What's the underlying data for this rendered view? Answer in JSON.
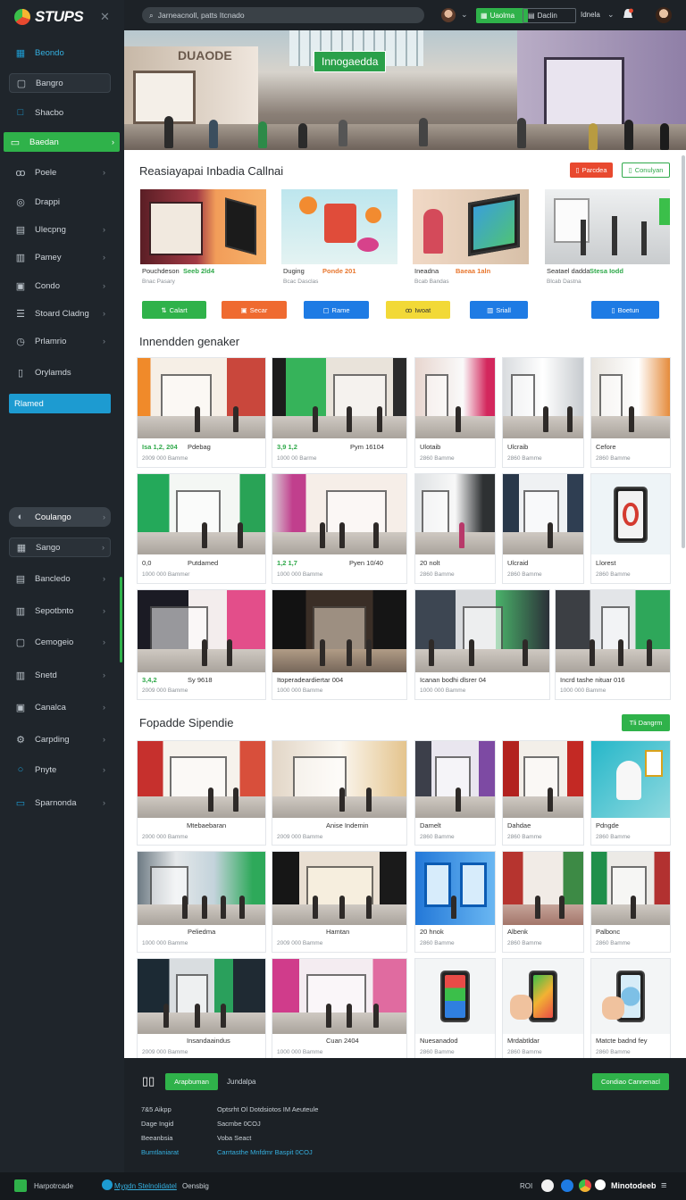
{
  "app": {
    "name": "STUPS"
  },
  "sidebar": {
    "items": [
      {
        "label": "Beondo",
        "icon": "grid-icon"
      },
      {
        "label": "Bangro",
        "icon": "square-icon"
      },
      {
        "label": "Shacbo",
        "icon": "square-outline-icon"
      },
      {
        "label": "Baedan",
        "icon": "monitor-icon"
      },
      {
        "label": "Poele",
        "icon": "users-icon"
      },
      {
        "label": "Drappi",
        "icon": "target-icon"
      },
      {
        "label": "Ulecpng",
        "icon": "panel-icon"
      },
      {
        "label": "Pamey",
        "icon": "table-icon"
      },
      {
        "label": "Condo",
        "icon": "calendar-icon"
      },
      {
        "label": "Stoard Cladng",
        "icon": "list-icon"
      },
      {
        "label": "Prlamrio",
        "icon": "clock-icon"
      },
      {
        "label": "Orylamds",
        "icon": "doc-icon"
      },
      {
        "label": "Rlamed",
        "icon": ""
      },
      {
        "label": "Coulango",
        "icon": ""
      },
      {
        "label": "Sango",
        "icon": "grid-icon"
      },
      {
        "label": "Bancledo",
        "icon": "briefcase-icon"
      },
      {
        "label": "Sepotbnto",
        "icon": "chart-icon"
      },
      {
        "label": "Cemogeio",
        "icon": "wallet-icon"
      },
      {
        "label": "Snetd",
        "icon": "building-icon"
      },
      {
        "label": "Canalca",
        "icon": "calendar-icon"
      },
      {
        "label": "Carpding",
        "icon": "settings-icon"
      },
      {
        "label": "Pnyte",
        "icon": "circle-icon"
      },
      {
        "label": "Sparnonda",
        "icon": "folder-icon"
      }
    ]
  },
  "topbar": {
    "search_placeholder": "Jarneacnoll, patts Itcnado",
    "btn_green": "Uaolma",
    "btn_dark": "Daclin",
    "text": "Idnela"
  },
  "hero": {
    "tag": "Innogaedda",
    "storefront_label": "DUAODE"
  },
  "section1": {
    "title": "Reasiayapai Inbadia Callnai",
    "btn_orange": "Parcdea",
    "btn_green": "Conulyan",
    "cards": [
      {
        "title": "Pouchdeson",
        "accent": "Seeb 2ld4",
        "meta": "Bnac  Pasary"
      },
      {
        "title": "Duging",
        "accent": "Ponde 201",
        "meta": "Bcac  Dasclas"
      },
      {
        "title": "Ineadna",
        "accent": "Baeaa 1aln",
        "meta": "Bcab  Bandas"
      },
      {
        "title": "Seatael dadda",
        "accent": "Stesa Iodd",
        "meta": "Blcab  Dastna"
      }
    ],
    "actions": [
      {
        "label": "Calart",
        "color": "#2fb24a",
        "icon": "sliders-icon"
      },
      {
        "label": "Secar",
        "color": "#ef6a30",
        "icon": "calendar-icon"
      },
      {
        "label": "Rame",
        "color": "#1e7be4",
        "icon": "frame-icon"
      },
      {
        "label": "Iwoat",
        "color": "#f2d937",
        "icon": "people-icon"
      },
      {
        "label": "Sriall",
        "color": "#1e7be4",
        "icon": "building-icon"
      },
      {
        "label": "Boetun",
        "color": "#1e7be4",
        "icon": "doc-icon"
      }
    ]
  },
  "section2": {
    "title": "Innendden genaker",
    "cards": [
      {
        "l1": "Isa 1,2,  204",
        "l1b": "Pdebag",
        "l2": "2009 000  Bamme",
        "accent": true
      },
      {
        "l1": "3,9  1,2",
        "l1b": "Pym  16104",
        "l2": "1000 00  Barme",
        "accent": true
      },
      {
        "l1": "Ulotaib",
        "l1b": "",
        "l2": "2860  Bamme",
        "accent": false
      },
      {
        "l1": "Ulcraib",
        "l1b": "",
        "l2": "2860  Bamme",
        "accent": false
      },
      {
        "l1": "Cefore",
        "l1b": "",
        "l2": "2860  Bamme",
        "accent": false
      },
      {
        "l1": "0,0",
        "l1b": "Putdamed",
        "l2": "1000 000  Bammer",
        "accent": false
      },
      {
        "l1": "1,2  1,7",
        "l1b": "Pyen  10/40",
        "l2": "1000 000  Bamme",
        "accent": true
      },
      {
        "l1": "20 nolt",
        "l1b": "",
        "l2": "2860  Bamme",
        "accent": false
      },
      {
        "l1": "Ulcraid",
        "l1b": "",
        "l2": "2860  Bamme",
        "accent": false
      },
      {
        "l1": "Llorest",
        "l1b": "",
        "l2": "2860  Bamme",
        "accent": false
      },
      {
        "l1": "3,4,2",
        "l1b": "Sy 9618",
        "l2": "2009 000  Bamme",
        "accent": true
      },
      {
        "l1": "Itoperadeardiertar  004",
        "l1b": "",
        "l2": "1000 000  Bamme",
        "accent": false
      },
      {
        "l1": "Icanan bodhi dlsrer  04",
        "l1b": "",
        "l2": "1000 000  Bamme",
        "accent": false
      },
      {
        "l1": "Incrd tashe nituar  016",
        "l1b": "",
        "l2": "1000 000  Bamme",
        "accent": false
      }
    ]
  },
  "section3": {
    "title": "Fopadde Sipendie",
    "btn": "Tli Dangrm",
    "cards": [
      {
        "l1": "Mtebaebaran",
        "l2": "2000 000  Bamme"
      },
      {
        "l1": "Anise Indemin",
        "l2": "2009 000  Bamme"
      },
      {
        "l1": "Damelt",
        "l2": "2860  Bamme"
      },
      {
        "l1": "Dahdae",
        "l2": "2860  Bamme"
      },
      {
        "l1": "Pdngde",
        "l2": "2860  Bamme"
      },
      {
        "l1": "Peliedma",
        "l2": "1000 000  Bamme"
      },
      {
        "l1": "Hamtan",
        "l2": "2009 000  Bamme"
      },
      {
        "l1": "20 hnok",
        "l2": "2860  Bamme"
      },
      {
        "l1": "Albenk",
        "l2": "2860  Bamme"
      },
      {
        "l1": "Palbonc",
        "l2": "2860  Bamme"
      },
      {
        "l1": "Insandaaindus",
        "l2": "2009 000  Bamme"
      },
      {
        "l1": "Cuan  2404",
        "l2": "1000 000  Bamme"
      },
      {
        "l1": "Nuesanadod",
        "l2": "2860  Bamme"
      },
      {
        "l1": "Mrdabtldar",
        "l2": "2860  Bamme"
      },
      {
        "l1": "Matcte badnd fey",
        "l2": "2860  Bamme"
      }
    ]
  },
  "footer": {
    "btn_green": "Arapbuman",
    "link": "Jundalpa",
    "btn_right": "Condiao Cannenacl",
    "col1": [
      "7&5  Aikpp",
      "Dage  Ingid",
      "Beeanbsia"
    ],
    "col1_link": "Bumtlaniarat",
    "col2": [
      "Optsrht  Ol Dotdsiotos  IM Aeuteule",
      "Sacmbe  0COJ",
      "Voba  Seact"
    ],
    "col2_link": "Carrtasthe  Mnfdmr Baspit  0COJ"
  },
  "status": {
    "left": "Harpotrcade",
    "link": "Mygdn  Stelnolidatel",
    "right_text": "Oensbig",
    "ind": "ROI",
    "brand": "Minotodeeb",
    "menu": "≡"
  }
}
